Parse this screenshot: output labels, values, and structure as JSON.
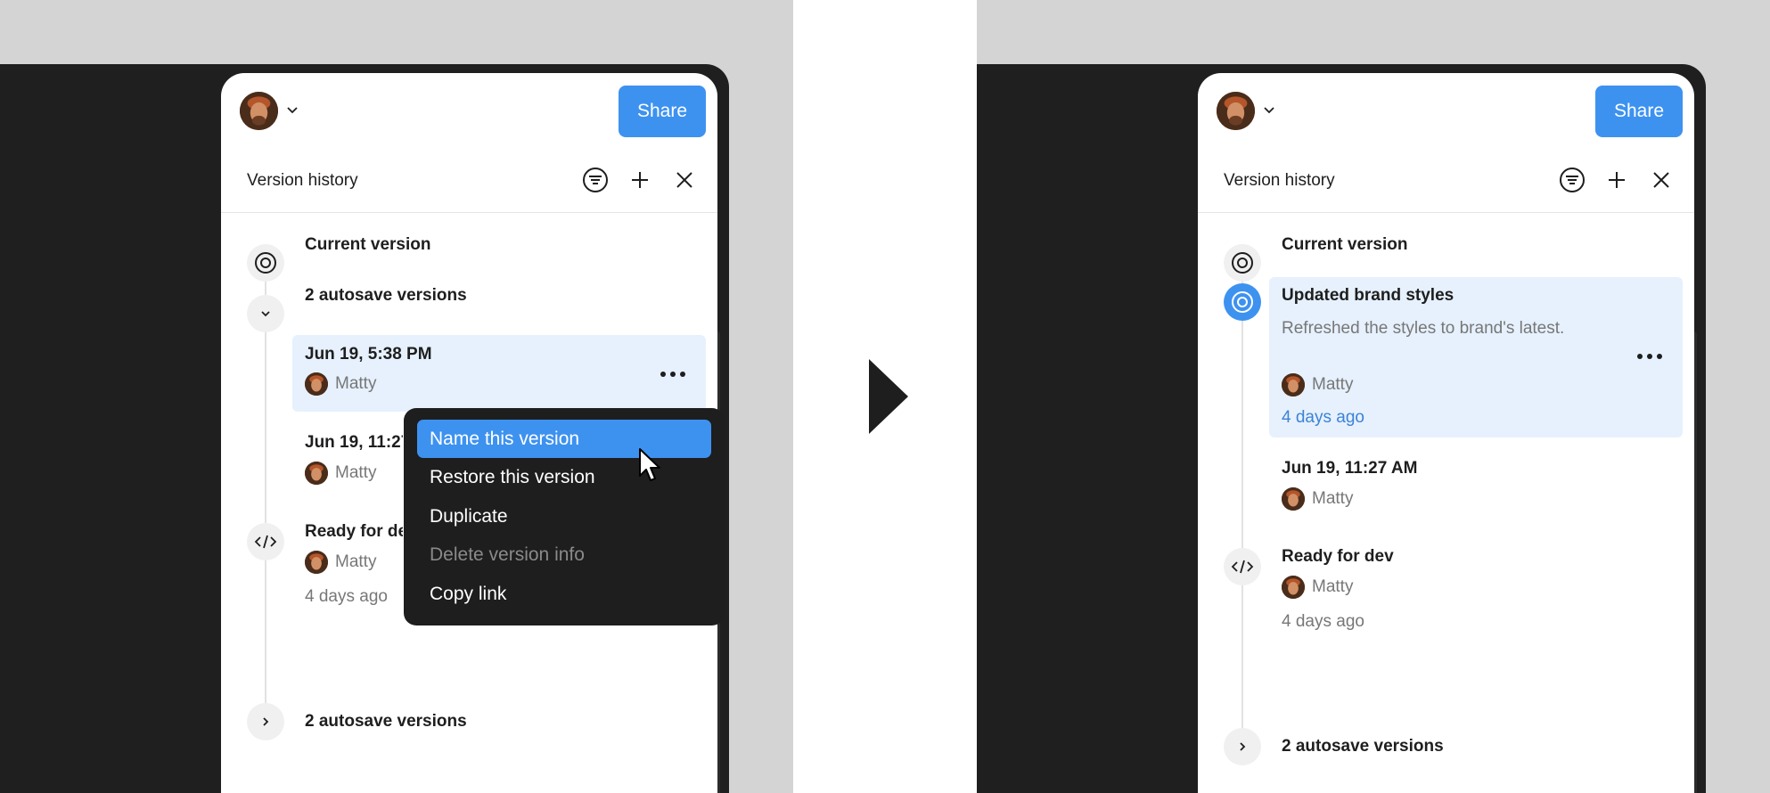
{
  "left": {
    "panel": {
      "share_label": "Share",
      "title": "Version history"
    },
    "rows": {
      "current": "Current version",
      "autosave_top": "2 autosave versions",
      "selected_title": "Jun 19, 5:38 PM",
      "selected_author": "Matty",
      "second_title": "Jun 19, 11:27 AM",
      "second_author": "Matty",
      "dev_title": "Ready for dev",
      "dev_author": "Matty",
      "dev_time": "4 days ago",
      "autosave_bottom": "2 autosave versions"
    },
    "context_menu": [
      {
        "label": "Name this version",
        "state": "highlighted"
      },
      {
        "label": "Restore this version",
        "state": "normal"
      },
      {
        "label": "Duplicate",
        "state": "normal"
      },
      {
        "label": "Delete version info",
        "state": "disabled"
      },
      {
        "label": "Copy link",
        "state": "normal"
      }
    ]
  },
  "right": {
    "panel": {
      "share_label": "Share",
      "title": "Version history"
    },
    "rows": {
      "current": "Current version",
      "named_title": "Updated brand styles",
      "named_desc": "Refreshed the styles to brand's latest.",
      "named_author": "Matty",
      "named_time": "4 days ago",
      "second_title": "Jun 19, 11:27 AM",
      "second_author": "Matty",
      "dev_title": "Ready for dev",
      "dev_author": "Matty",
      "dev_time": "4 days ago",
      "autosave_bottom": "2 autosave versions"
    }
  },
  "icons": [
    "avatar",
    "chevron-down-icon",
    "filter-icon",
    "plus-icon",
    "close-icon",
    "target-icon",
    "code-icon",
    "chevron-right-icon",
    "more-icon",
    "pointer-cursor-icon",
    "play-arrow-icon"
  ],
  "colors": {
    "accent": "#3d92f0",
    "selection": "#e6f1fd",
    "menu_bg": "#1e1e1e",
    "device_bg": "#1f1f1f",
    "backdrop": "#d4d4d4"
  }
}
